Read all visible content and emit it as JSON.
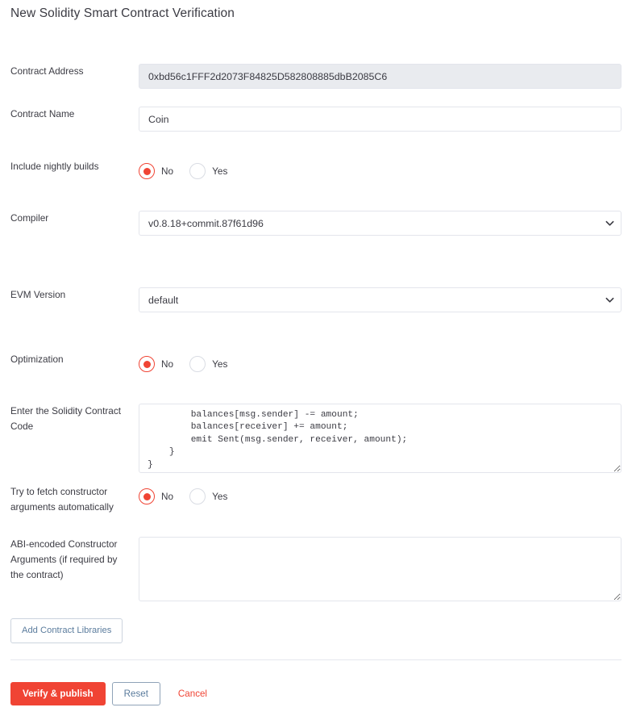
{
  "page": {
    "title": "New Solidity Smart Contract Verification"
  },
  "form": {
    "contract_address": {
      "label": "Contract Address",
      "value": "0xbd56c1FFF2d2073F84825D582808885dbB2085C6",
      "placeholder": "",
      "readonly": true
    },
    "contract_name": {
      "label": "Contract Name",
      "value": "Coin",
      "placeholder": ""
    },
    "nightly_builds": {
      "label": "Include nightly builds",
      "options": [
        "No",
        "Yes"
      ],
      "selected": "No"
    },
    "compiler": {
      "label": "Compiler",
      "value": "v0.8.18+commit.87f61d96",
      "options": [
        "v0.8.18+commit.87f61d96"
      ]
    },
    "evm_version": {
      "label": "EVM Version",
      "value": "default",
      "options": [
        "default"
      ]
    },
    "optimization": {
      "label": "Optimization",
      "options": [
        "No",
        "Yes"
      ],
      "selected": "No"
    },
    "contract_code": {
      "label": "Enter the Solidity Contract Code",
      "value": "        balances[msg.sender] -= amount;\n        balances[receiver] += amount;\n        emit Sent(msg.sender, receiver, amount);\n    }\n}",
      "placeholder": ""
    },
    "fetch_constructor_args": {
      "label": "Try to fetch constructor arguments automatically",
      "options": [
        "No",
        "Yes"
      ],
      "selected": "No"
    },
    "abi_constructor_args": {
      "label": "ABI-encoded Constructor Arguments (if required by the contract)",
      "value": "",
      "placeholder": ""
    }
  },
  "actions": {
    "add_libraries": "Add Contract Libraries",
    "verify_publish": "Verify & publish",
    "reset": "Reset",
    "cancel": "Cancel"
  },
  "colors": {
    "primary_red": "#f04434",
    "link_blue": "#5b7c9d",
    "border": "#e3e5ec",
    "readonly_bg": "#e9ebef",
    "text": "#3b3b43"
  }
}
